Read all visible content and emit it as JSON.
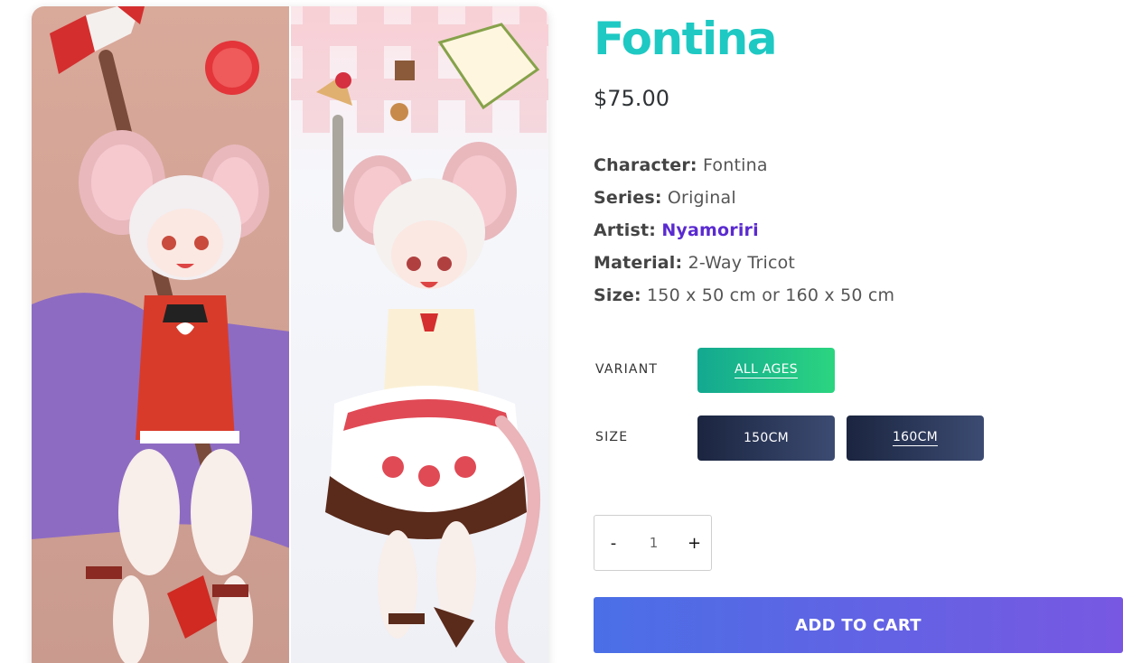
{
  "product": {
    "title": "Fontina",
    "price": "$75.00",
    "image_alt": "Fontina dakimakura artwork (front and back)"
  },
  "specs": [
    {
      "key": "Character:",
      "value": "Fontina"
    },
    {
      "key": "Series:",
      "value": "Original"
    },
    {
      "key": "Artist:",
      "value": "Nyamoriri"
    },
    {
      "key": "Material:",
      "value": "2-Way Tricot"
    },
    {
      "key": "Size:",
      "value": "150 x 50 cm or 160 x 50 cm"
    }
  ],
  "options": {
    "variant_label": "VARIANT",
    "variant_value": "ALL AGES",
    "size_label": "SIZE",
    "sizes": [
      "150CM",
      "160CM"
    ],
    "selected_size": "160CM"
  },
  "quantity": {
    "minus": "-",
    "value": "1",
    "plus": "+"
  },
  "cart": {
    "add_label": "ADD TO CART"
  },
  "colors": {
    "title": "#1ec9c3",
    "artist_link": "#5a2ad0",
    "variant_button": "#13a891",
    "size_button": "#1b2540",
    "cart_button": "#4a6fe6"
  }
}
